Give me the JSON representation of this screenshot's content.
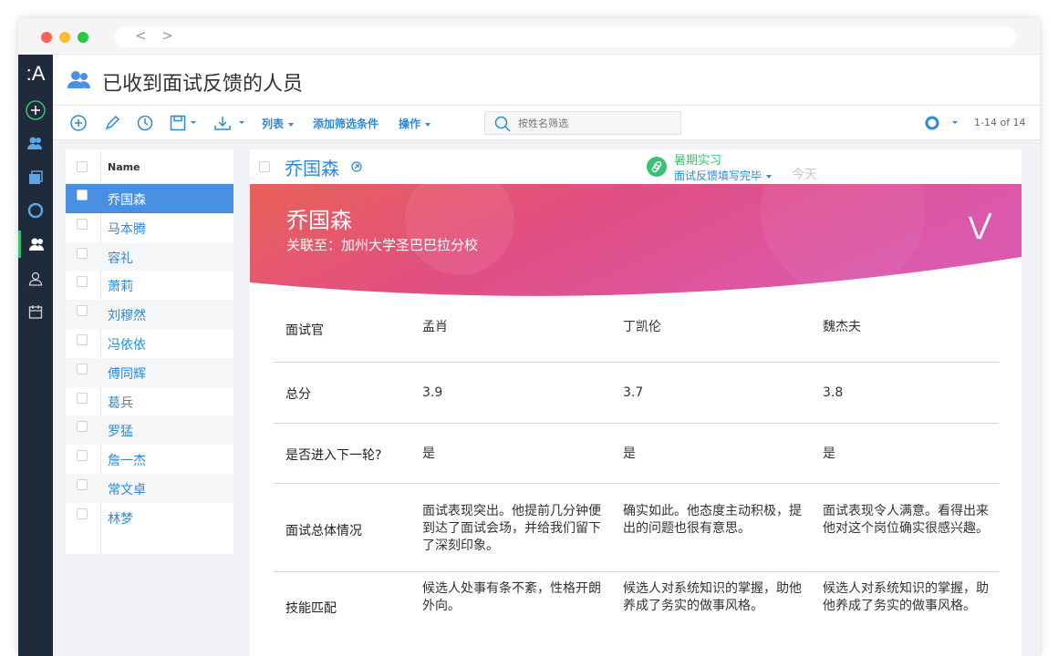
{
  "window": {
    "nav_arrows": "< >"
  },
  "nav": {
    "logo": ":A"
  },
  "header": {
    "title": "已收到面试反馈的人员"
  },
  "toolbar": {
    "list_label": "列表",
    "add_filter_label": "添加筛选条件",
    "actions_label": "操作",
    "search_placeholder": "按姓名筛选",
    "pager": "1-14 of 14"
  },
  "list": {
    "column_header": "Name",
    "items": [
      "乔国森",
      "马本腾",
      "容礼",
      "萧莉",
      "刘穆然",
      "冯依依",
      "傅同辉",
      "葛兵",
      "罗猛",
      "詹一杰",
      "常文卓",
      "林梦"
    ],
    "selected_index": 0
  },
  "detail": {
    "name": "乔国森",
    "tag_title": "暑期实习",
    "tag_status": "面试反馈填写完毕",
    "date": "今天",
    "banner_name": "乔国森",
    "banner_sub": "关联至：加州大学圣巴巴拉分校",
    "interviewers_label": "面试官",
    "interviewers": [
      "孟肖",
      "丁凯伦",
      "魏杰夫"
    ],
    "rows": [
      {
        "label": "总分",
        "values": [
          "3.9",
          "3.7",
          "3.8"
        ]
      },
      {
        "label": "是否进入下一轮?",
        "values": [
          "是",
          "是",
          "是"
        ]
      },
      {
        "label": "面试总体情况",
        "values": [
          "面试表现突出。他提前几分钟便到达了面试会场，并给我们留下了深刻印象。",
          "确实如此。他态度主动积极，提出的问题也很有意思。",
          "面试表现令人满意。看得出来他对这个岗位确实很感兴趣。"
        ]
      },
      {
        "label": "技能匹配",
        "values": [
          "候选人处事有条不紊，性格开朗外向。",
          "候选人对系统知识的掌握，助他养成了务实的做事风格。",
          "候选人对系统知识的掌握，助他养成了务实的做事风格。"
        ]
      }
    ]
  },
  "colors": {
    "accent_blue": "#2d8ad8",
    "accent_green": "#38c172",
    "nav_bg": "#1f2a3a",
    "selected_row": "#4a90e2"
  }
}
